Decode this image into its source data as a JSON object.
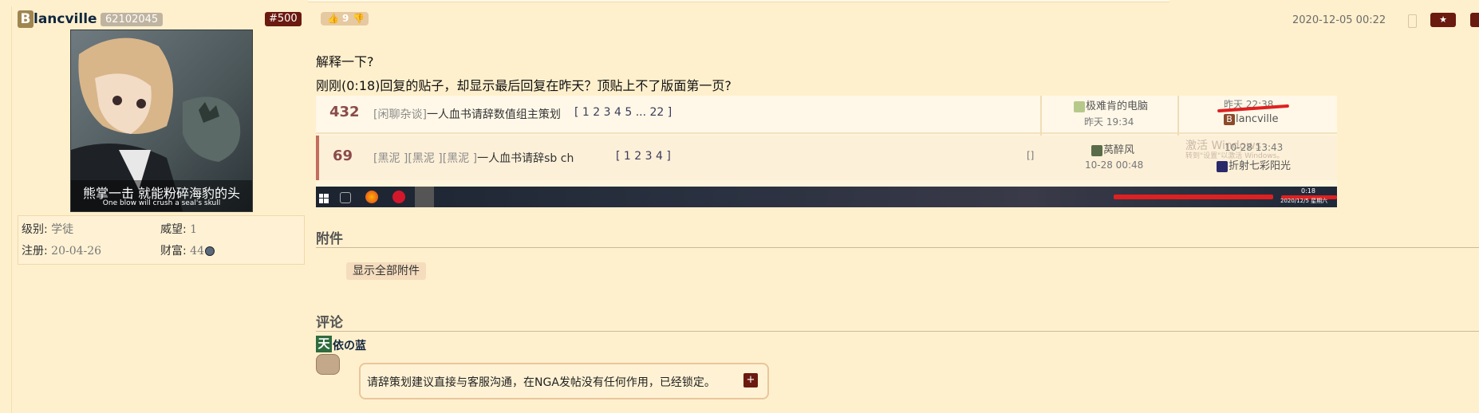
{
  "author": {
    "initial": "B",
    "name": "lancville",
    "uid": "62102045",
    "floor": "#500",
    "avatar_caption_cn": "熊掌一击 就能粉碎海豹的头",
    "avatar_caption_en": "One blow will crush a seal's skull"
  },
  "stats": {
    "level_label": "级别:",
    "level_value": "学徒",
    "prestige_label": "威望:",
    "prestige_value": "1",
    "register_label": "注册:",
    "register_value": "20-04-26",
    "wealth_label": "财富:",
    "wealth_value": "44"
  },
  "vote": {
    "count": "9"
  },
  "post": {
    "timestamp": "2020-12-05 00:22",
    "line1": "解释一下?",
    "line2": "刚刚(0:18)回复的贴子，却显示最后回复在昨天？顶贴上不了版面第一页?"
  },
  "screenshot": {
    "row1": {
      "count": "432",
      "tag": "[闲聊杂谈]",
      "title": "一人血书请辞数值组主策划",
      "pages": "[ 1 2 3 4 5 ... 22 ]",
      "author": "极难肯的电脑",
      "author_time": "昨天 19:34",
      "last_time": "昨天 22:38",
      "last_user": "lancville",
      "last_user_initial": "B"
    },
    "row2": {
      "count": "69",
      "tag": "[黑泥 ][黑泥 ][黑泥 ]",
      "title": "一人血书请辞sb ch",
      "pages": "[ 1 2 3 4 ]",
      "bracket": "[]",
      "author": "莴醉风",
      "author_time": "10-28 00:48",
      "last_time": "10-28 13:43",
      "last_user": "折射七彩阳光",
      "watermark_1": "激活 Windows",
      "watermark_2": "转到\"设置\"以激活 Windows。"
    },
    "taskbar": {
      "time": "0:18",
      "date": "2020/12/5 星期六"
    }
  },
  "attachments": {
    "heading": "附件",
    "show_all_label": "显示全部附件"
  },
  "comments": {
    "heading": "评论",
    "items": [
      {
        "initial": "天",
        "user": "依の蓝",
        "text": "请辞策划建议直接与客服沟通，在NGA发帖没有任何作用，已经锁定。",
        "plus": "+"
      }
    ]
  }
}
